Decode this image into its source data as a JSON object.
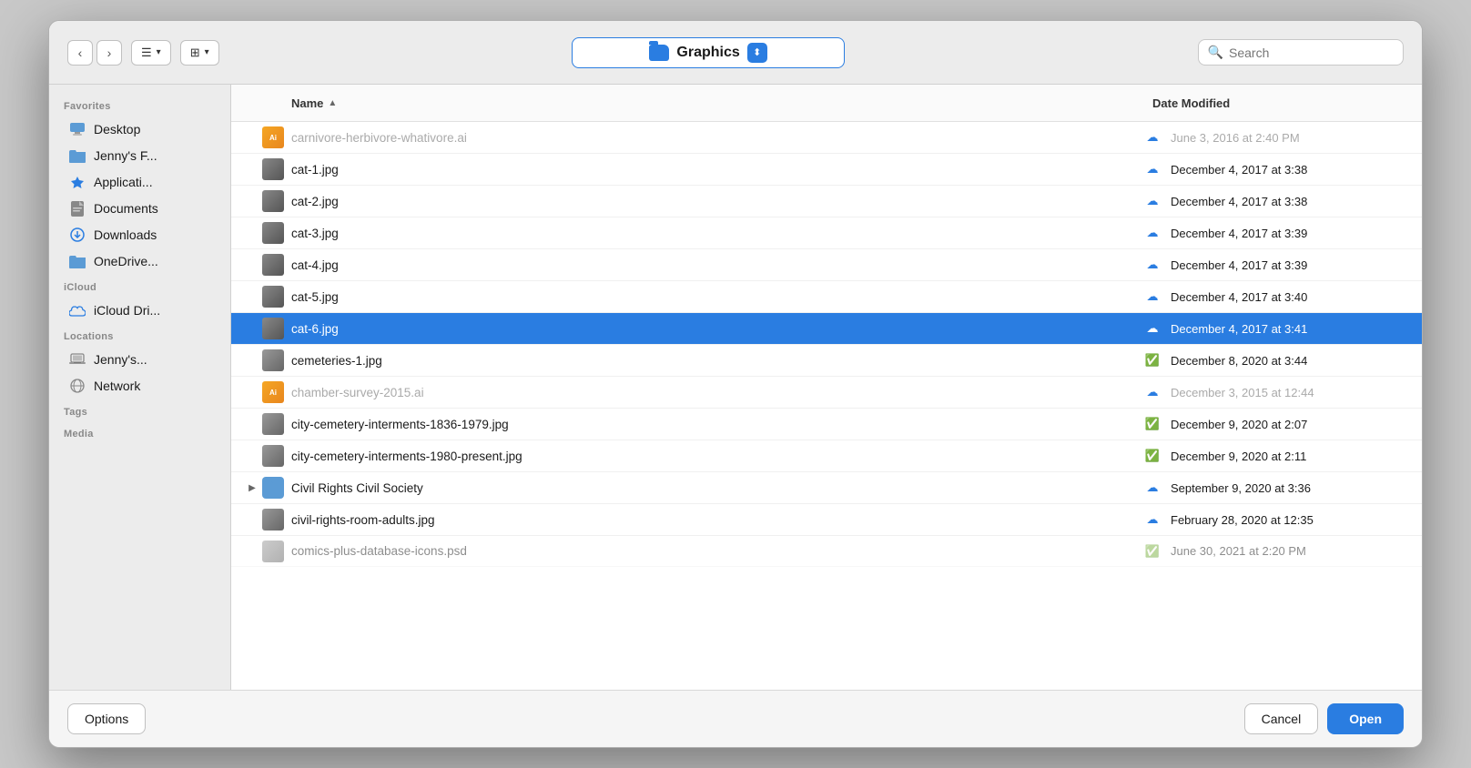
{
  "toolbar": {
    "back_label": "‹",
    "forward_label": "›",
    "list_view_label": "☰",
    "grid_view_label": "⊞",
    "folder_name": "Graphics",
    "search_placeholder": "Search",
    "chevron_label": "⬍"
  },
  "sidebar": {
    "favorites_label": "Favorites",
    "icloud_label": "iCloud",
    "locations_label": "Locations",
    "tags_label": "Tags",
    "media_label": "Media",
    "items": [
      {
        "id": "desktop",
        "label": "Desktop",
        "icon": "desktop"
      },
      {
        "id": "jennys-f",
        "label": "Jenny's F...",
        "icon": "folder"
      },
      {
        "id": "applications",
        "label": "Applicati...",
        "icon": "apps"
      },
      {
        "id": "documents",
        "label": "Documents",
        "icon": "doc"
      },
      {
        "id": "downloads",
        "label": "Downloads",
        "icon": "download"
      },
      {
        "id": "onedrive",
        "label": "OneDrive...",
        "icon": "folder"
      },
      {
        "id": "icloud-drive",
        "label": "iCloud Dri...",
        "icon": "cloud"
      },
      {
        "id": "jennys-loc",
        "label": "Jenny's...",
        "icon": "laptop"
      },
      {
        "id": "network",
        "label": "Network",
        "icon": "network"
      }
    ]
  },
  "file_list": {
    "col_name": "Name",
    "col_date": "Date Modified",
    "files": [
      {
        "name": "carnivore-herbivore-whativore.ai",
        "date": "June 3, 2016 at 2:40 PM",
        "type": "ai",
        "cloud": "blue",
        "dimmed": true
      },
      {
        "name": "cat-1.jpg",
        "date": "December 4, 2017 at 3:38",
        "type": "jpg-cat",
        "cloud": "blue",
        "dimmed": false
      },
      {
        "name": "cat-2.jpg",
        "date": "December 4, 2017 at 3:38",
        "type": "jpg-cat",
        "cloud": "blue",
        "dimmed": false
      },
      {
        "name": "cat-3.jpg",
        "date": "December 4, 2017 at 3:39",
        "type": "jpg-cat",
        "cloud": "blue",
        "dimmed": false
      },
      {
        "name": "cat-4.jpg",
        "date": "December 4, 2017 at 3:39",
        "type": "jpg-cat",
        "cloud": "blue",
        "dimmed": false
      },
      {
        "name": "cat-5.jpg",
        "date": "December 4, 2017 at 3:40",
        "type": "jpg-cat",
        "cloud": "blue",
        "dimmed": false
      },
      {
        "name": "cat-6.jpg",
        "date": "December 4, 2017 at 3:41",
        "type": "jpg-cat",
        "cloud": "white",
        "selected": true
      },
      {
        "name": "cemeteries-1.jpg",
        "date": "December 8, 2020 at 3:44",
        "type": "jpg-cem",
        "cloud": "green",
        "dimmed": false
      },
      {
        "name": "chamber-survey-2015.ai",
        "date": "December 3, 2015 at 12:44",
        "type": "ai",
        "cloud": "blue",
        "dimmed": true
      },
      {
        "name": "city-cemetery-interments-1836-1979.jpg",
        "date": "December 9, 2020 at 2:07",
        "type": "jpg-cem",
        "cloud": "green",
        "dimmed": false
      },
      {
        "name": "city-cemetery-interments-1980-present.jpg",
        "date": "December 9, 2020 at 2:11",
        "type": "jpg-cem",
        "cloud": "green",
        "dimmed": false
      },
      {
        "name": "Civil Rights Civil Society",
        "date": "September 9, 2020 at 3:36",
        "type": "folder",
        "cloud": "blue",
        "dimmed": false,
        "is_folder": true
      },
      {
        "name": "civil-rights-room-adults.jpg",
        "date": "February 28, 2020 at 12:35",
        "type": "jpg-cem",
        "cloud": "blue",
        "dimmed": false
      },
      {
        "name": "comics-plus-database-icons.psd",
        "date": "June 30, 2021 at 2:20 PM",
        "type": "jpg-cem",
        "cloud": "green",
        "dimmed": false,
        "partial": true
      }
    ]
  },
  "bottom": {
    "options_label": "Options",
    "cancel_label": "Cancel",
    "open_label": "Open"
  }
}
